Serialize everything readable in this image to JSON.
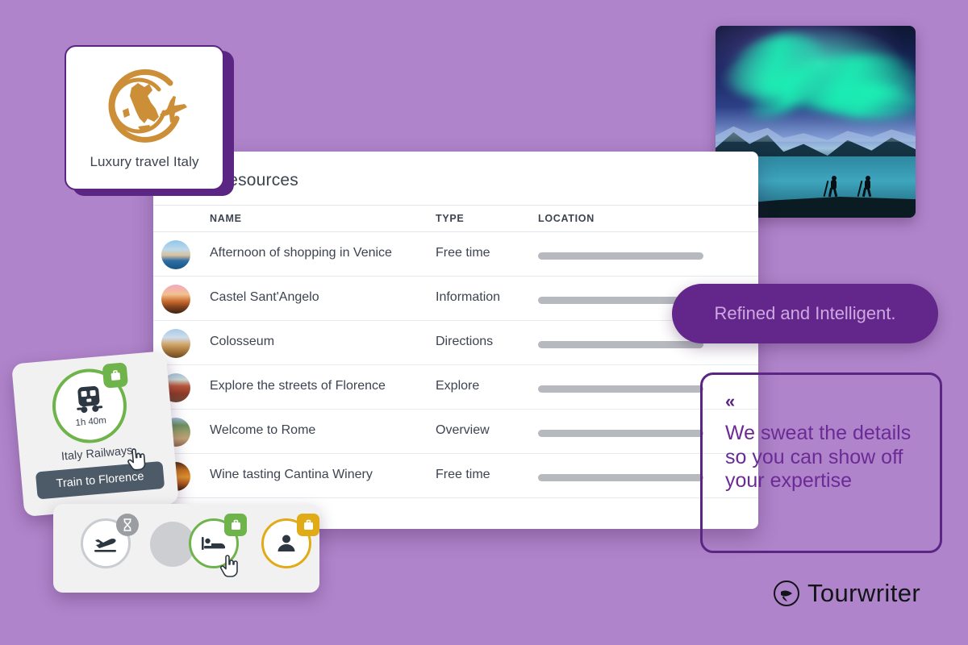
{
  "background_color": "#b084ca",
  "logo_card": {
    "caption": "Luxury travel Italy",
    "mark_name": "italy-globe-airplane-icon",
    "accent_color": "#cd8e38",
    "border_color": "#5b2583"
  },
  "aurora_card": {
    "alt": "aurora-borealis-hikers-photo"
  },
  "resources_table": {
    "title": "resources",
    "columns": [
      "NAME",
      "TYPE",
      "LOCATION"
    ],
    "rows": [
      {
        "name": "Afternoon of shopping in Venice",
        "type": "Free time",
        "location": "",
        "thumb": "venice"
      },
      {
        "name": "Castel Sant'Angelo",
        "type": "Information",
        "location": "",
        "thumb": "castel"
      },
      {
        "name": "Colosseum",
        "type": "Directions",
        "location": "",
        "thumb": "colosseum"
      },
      {
        "name": "Explore the streets of Florence",
        "type": "Explore",
        "location": "",
        "thumb": "florence"
      },
      {
        "name": "Welcome to Rome",
        "type": "Overview",
        "location": "",
        "thumb": "rome"
      },
      {
        "name": "Wine tasting Cantina Winery",
        "type": "Free time",
        "location": "",
        "thumb": "wine"
      }
    ]
  },
  "pill_badge": {
    "text": "Refined and Intelligent.",
    "background_color": "#63278c",
    "text_color": "#cfa8e2"
  },
  "quote_box": {
    "quote_mark": "«",
    "text": "We sweat the details so you can show off your expertise",
    "border_color": "#5b2583",
    "text_color": "#6b2b96"
  },
  "brand": {
    "name": "Tourwriter",
    "mark_name": "tourwriter-circle-arrow-logo"
  },
  "train_card": {
    "duration": "1h 40m",
    "operator": "Italy Railways",
    "tooltip": "Train to Florence",
    "icon_name": "train-icon",
    "badge_icon_name": "briefcase-icon",
    "ring_color": "#6eb44a"
  },
  "icon_bar": {
    "items": [
      {
        "icon_name": "airplane-landing-icon",
        "ring_color": "#c9ccd1",
        "badge_icon_name": "hourglass-icon",
        "badge_color": "#9a9da2"
      },
      {
        "icon_name": "placeholder-dot-icon",
        "ring_color": "#cdced2",
        "badge_icon_name": "",
        "badge_color": ""
      },
      {
        "icon_name": "bed-icon",
        "ring_color": "#6eb44a",
        "badge_icon_name": "briefcase-icon",
        "badge_color": "#6eb44a"
      },
      {
        "icon_name": "person-icon",
        "ring_color": "#e0ab16",
        "badge_icon_name": "briefcase-icon",
        "badge_color": "#e0ab16"
      }
    ]
  }
}
